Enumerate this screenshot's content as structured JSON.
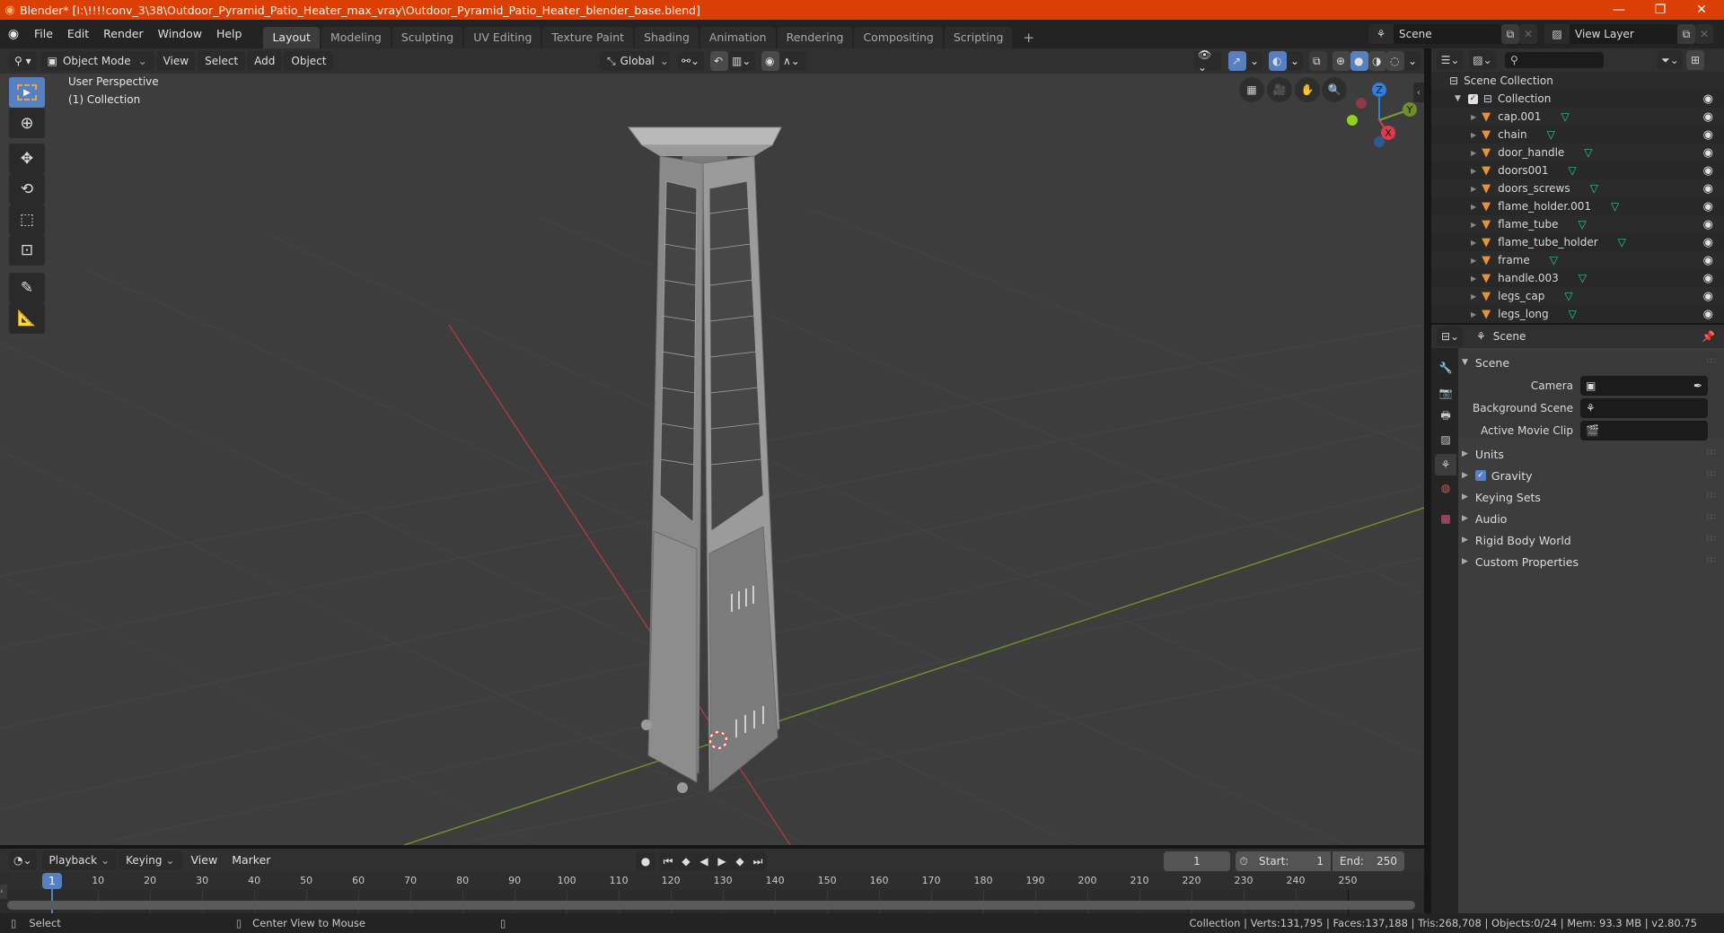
{
  "window": {
    "title": "Blender* [I:\\!!!!conv_3\\38\\Outdoor_Pyramid_Patio_Heater_max_vray\\Outdoor_Pyramid_Patio_Heater_blender_base.blend]",
    "minimize": "—",
    "maximize": "❐",
    "close": "✕"
  },
  "menu": [
    "File",
    "Edit",
    "Render",
    "Window",
    "Help"
  ],
  "workspaces": [
    "Layout",
    "Modeling",
    "Sculpting",
    "UV Editing",
    "Texture Paint",
    "Shading",
    "Animation",
    "Rendering",
    "Compositing",
    "Scripting"
  ],
  "workspace_add": "+",
  "active_workspace": "Layout",
  "scene_selector": {
    "value": "Scene"
  },
  "view_layer_selector": {
    "value": "View Layer"
  },
  "viewport_header": {
    "mode": "Object Mode",
    "menus": [
      "View",
      "Select",
      "Add",
      "Object"
    ],
    "orientation": "Global"
  },
  "viewport": {
    "perspective_label": "User Perspective",
    "collection_label": "(1) Collection",
    "gizmo": {
      "z": "Z",
      "y": "Y",
      "x": "X"
    },
    "colors": {
      "x_axis": "#c8414b",
      "y_axis": "#7aa12c",
      "z_axis": "#2f7fde",
      "active_tool": "#5680c2"
    }
  },
  "outliner": {
    "root": "Scene Collection",
    "collection": "Collection",
    "objects": [
      "cap.001",
      "chain",
      "door_handle",
      "doors001",
      "doors_screws",
      "flame_holder.001",
      "flame_tube",
      "flame_tube_holder",
      "frame",
      "handle.003",
      "legs_cap",
      "legs_long"
    ]
  },
  "properties": {
    "context": "Scene",
    "panel_title": "Scene",
    "fields": [
      {
        "label": "Camera",
        "value": ""
      },
      {
        "label": "Background Scene",
        "value": ""
      },
      {
        "label": "Active Movie Clip",
        "value": ""
      }
    ],
    "collapsed_panels": [
      "Units",
      "Gravity",
      "Keying Sets",
      "Audio",
      "Rigid Body World",
      "Custom Properties"
    ],
    "gravity_enabled": true
  },
  "timeline": {
    "menus": [
      "Playback",
      "Keying",
      "View",
      "Marker"
    ],
    "current_frame": "1",
    "start_label": "Start:",
    "start": "1",
    "end_label": "End:",
    "end": "250",
    "ruler_current": "1",
    "ruler_ticks": [
      "10",
      "20",
      "30",
      "40",
      "50",
      "60",
      "70",
      "80",
      "90",
      "100",
      "110",
      "120",
      "130",
      "140",
      "150",
      "160",
      "170",
      "180",
      "190",
      "200",
      "210",
      "220",
      "230",
      "240",
      "250"
    ]
  },
  "statusbar": {
    "left_hint": "Select",
    "middle_hint": "Center View to Mouse",
    "stats": "Collection | Verts:131,795 | Faces:137,188 | Tris:268,708 | Objects:0/24 | Mem: 93.3 MB | v2.80.75"
  }
}
